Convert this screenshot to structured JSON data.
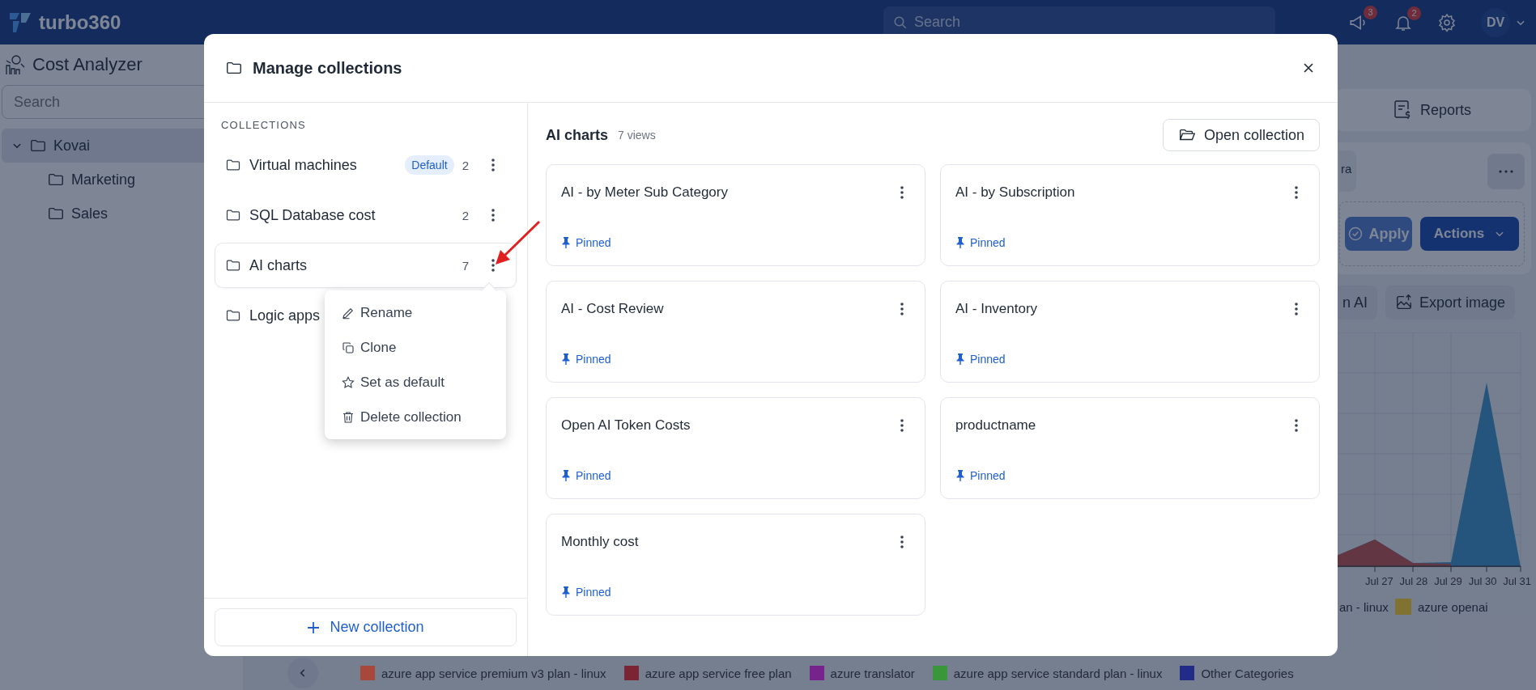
{
  "topbar": {
    "brand": "turbo360",
    "search": {
      "placeholder": "Search"
    },
    "announcements_badge": "3",
    "notifications_badge": "2",
    "avatar": "DV"
  },
  "sidebar": {
    "title": "Cost Analyzer",
    "search": {
      "placeholder": "Search"
    },
    "tree": [
      {
        "label": "Kovai",
        "expanded": true,
        "selected": true,
        "children": [
          {
            "label": "Marketing",
            "selected": false
          },
          {
            "label": "Sales",
            "selected": false
          }
        ]
      }
    ]
  },
  "main": {
    "reports_tab": "Reports",
    "filter_chip": "ra",
    "apply_button": "Apply",
    "actions_button": "Actions",
    "ai_button": "n AI",
    "export_button": "Export image",
    "chart": {
      "x_labels": [
        "Jul 27",
        "Jul 28",
        "Jul 29",
        "Jul 30",
        "Jul 31"
      ],
      "legend": [
        {
          "label": "an - linux"
        },
        {
          "label": "azure openai",
          "color": "#807230"
        }
      ]
    },
    "bottom_legend": [
      {
        "label": "azure app service premium v3 plan - linux",
        "color": "#a8483a"
      },
      {
        "label": "azure app service free plan",
        "color": "#7a2434"
      },
      {
        "label": "azure translator",
        "color": "#76248c"
      },
      {
        "label": "azure app service standard plan - linux",
        "color": "#3a963a"
      },
      {
        "label": "Other Categories",
        "color": "#222c88"
      }
    ]
  },
  "modal": {
    "title": "Manage collections",
    "section_label": "COLLECTIONS",
    "collections": [
      {
        "name": "Virtual machines",
        "badge": "Default",
        "count": "2",
        "selected": false
      },
      {
        "name": "SQL Database cost",
        "count": "2",
        "selected": false
      },
      {
        "name": "AI charts",
        "count": "7",
        "selected": true,
        "menu": [
          {
            "kind": "rename",
            "label": "Rename"
          },
          {
            "kind": "clone",
            "label": "Clone"
          },
          {
            "kind": "default",
            "label": "Set as default"
          },
          {
            "kind": "delete",
            "label": "Delete collection"
          }
        ]
      },
      {
        "name": "Logic apps",
        "selected": false
      }
    ],
    "new_button": "New collection",
    "detail": {
      "title": "AI charts",
      "subtitle": "7 views",
      "open_button": "Open collection",
      "views": [
        {
          "title": "AI - by Meter Sub Category",
          "pinned": "Pinned"
        },
        {
          "title": "AI - by Subscription",
          "pinned": "Pinned"
        },
        {
          "title": "AI - Cost Review",
          "pinned": "Pinned"
        },
        {
          "title": "AI - Inventory",
          "pinned": "Pinned"
        },
        {
          "title": "Open AI Token Costs",
          "pinned": "Pinned"
        },
        {
          "title": "productname",
          "pinned": "Pinned"
        },
        {
          "title": "Monthly cost",
          "pinned": "Pinned"
        }
      ]
    }
  }
}
